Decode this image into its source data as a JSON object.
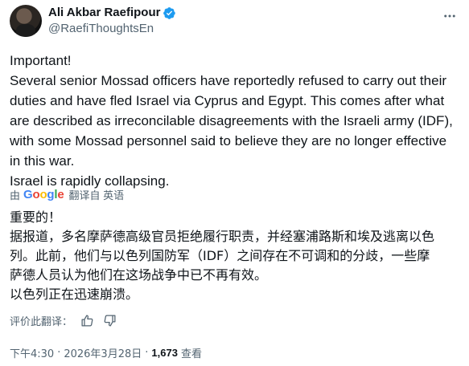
{
  "author": {
    "name": "Ali Akbar Raefipour",
    "handle": "@RaefiThoughtsEn",
    "verified_color": "#1d9bf0"
  },
  "tweet": {
    "lines": [
      "Important!",
      "Several senior Mossad officers have reportedly refused to carry out their",
      "duties and have fled Israel via Cyprus and Egypt. This comes after what",
      "are described as irreconcilable disagreements with the Israeli army (IDF),",
      "with some Mossad personnel said to believe they are no longer effective",
      "in this war.",
      "Israel is rapidly collapsing."
    ]
  },
  "translation": {
    "by_label": "由",
    "provider": "Google",
    "action_label": "翻译自 英语",
    "lines": [
      "重要的！",
      "据报道，多名摩萨德高级官员拒绝履行职责，并经塞浦路斯和埃及逃离以色",
      "列。此前，他们与以色列国防军（IDF）之间存在不可调和的分歧，一些摩",
      "萨德人员认为他们在这场战争中已不再有效。",
      "以色列正在迅速崩溃。"
    ],
    "rate_label": "评价此翻译："
  },
  "meta": {
    "time": "下午4:30",
    "date": "2026年3月28日",
    "views_count": "1,673",
    "views_label": "查看"
  },
  "icons": {
    "more": "more-icon",
    "verified": "verified-badge-icon",
    "thumbs_up": "thumbs-up-icon",
    "thumbs_down": "thumbs-down-icon"
  }
}
